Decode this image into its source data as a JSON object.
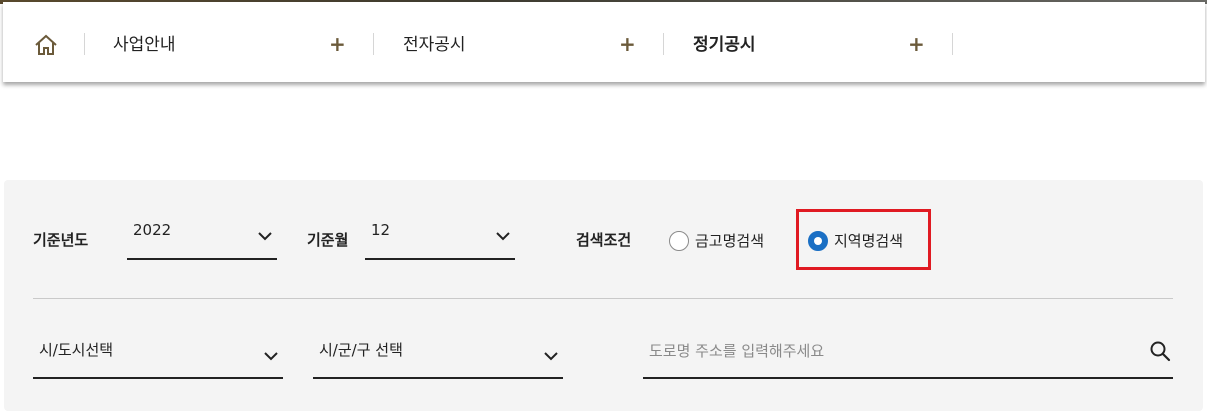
{
  "nav": {
    "items": [
      {
        "label": "사업안내"
      },
      {
        "label": "전자공시"
      },
      {
        "label": "정기공시"
      }
    ],
    "plus": "+"
  },
  "filters": {
    "year_label": "기준년도",
    "year_value": "2022",
    "month_label": "기준월",
    "month_value": "12",
    "condition_label": "검색조건",
    "radio_options": [
      {
        "label": "금고명검색",
        "selected": false
      },
      {
        "label": "지역명검색",
        "selected": true
      }
    ],
    "city_select": "시/도시선택",
    "district_select": "시/군/구 선택",
    "address_placeholder": "도로명 주소를 입력해주세요"
  },
  "colors": {
    "accent": "#1a6fc4",
    "highlight": "#e01a22",
    "plus": "#6b5a3a"
  },
  "icons": [
    "home-icon",
    "chevron-down-icon",
    "search-icon"
  ]
}
